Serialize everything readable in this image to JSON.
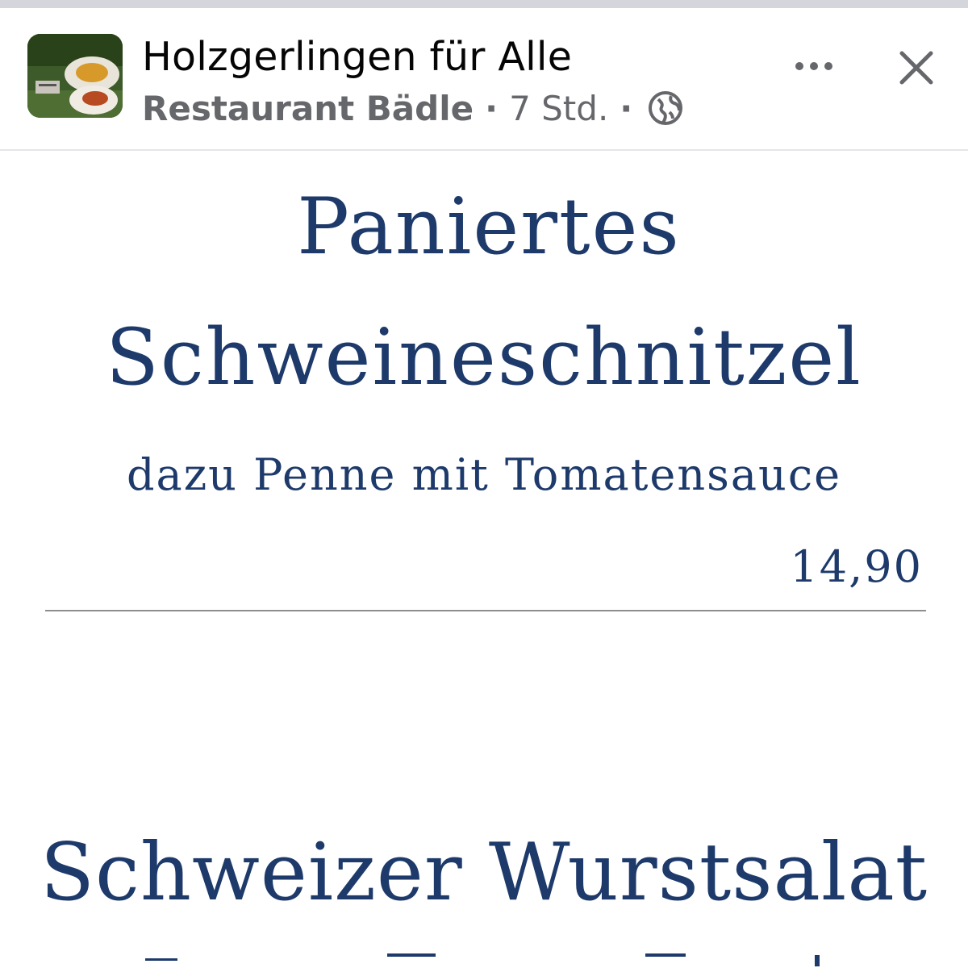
{
  "header": {
    "group_name": "Holzgerlingen für Alle",
    "author": "Restaurant Bädle",
    "separator": "·",
    "time_ago": "7 Std.",
    "privacy_icon": "globe-icon",
    "more_icon": "more-horizontal-icon",
    "close_icon": "close-icon"
  },
  "menu": {
    "dish1": {
      "title_line1": "Paniertes",
      "title_line2": "Schweineschnitzel",
      "description": "dazu Penne mit Tomatensauce",
      "price": "14,90"
    },
    "dish2": {
      "title": "Schweizer Wurstsalat"
    }
  },
  "colors": {
    "menu_text": "#1d3a6b",
    "header_title": "#050505",
    "header_meta": "#65676b",
    "divider": "#8e8e8e"
  }
}
